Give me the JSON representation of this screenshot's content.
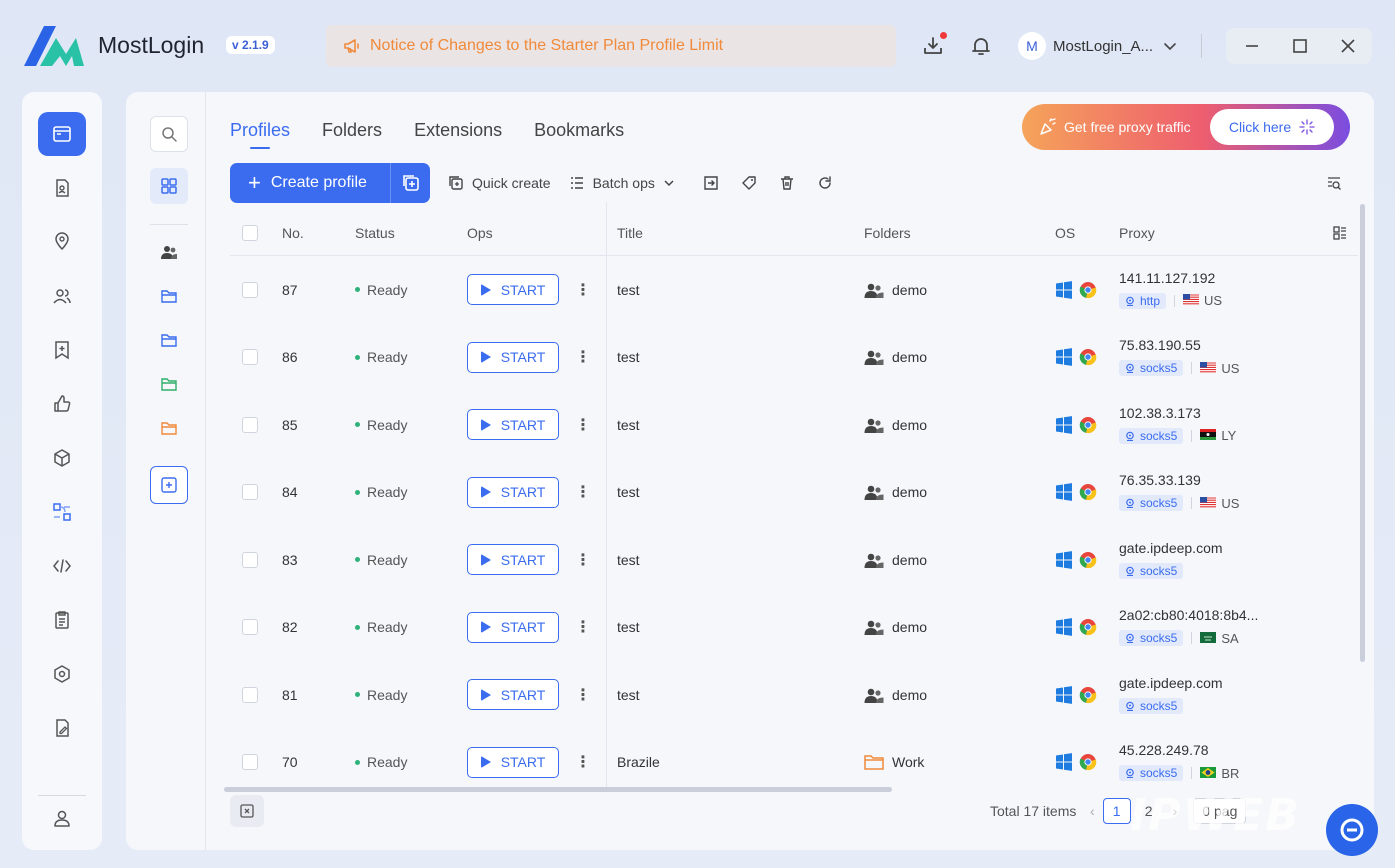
{
  "app": {
    "name": "MostLogin",
    "version": "v 2.1.9"
  },
  "notice": "Notice of Changes to the Starter Plan Profile Limit",
  "user": {
    "avatar_letter": "M",
    "name": "MostLogin_A..."
  },
  "tabs": [
    {
      "label": "Profiles",
      "active": true
    },
    {
      "label": "Folders",
      "active": false
    },
    {
      "label": "Extensions",
      "active": false
    },
    {
      "label": "Bookmarks",
      "active": false
    }
  ],
  "promo": {
    "text": "Get free proxy traffic",
    "button": "Click here"
  },
  "toolbar": {
    "create_label": "Create profile",
    "quick_create": "Quick create",
    "batch_ops": "Batch ops"
  },
  "table": {
    "headers": {
      "no": "No.",
      "status": "Status",
      "ops": "Ops",
      "title": "Title",
      "folders": "Folders",
      "os": "OS",
      "proxy": "Proxy"
    },
    "start_label": "START",
    "rows": [
      {
        "no": "87",
        "status": "Ready",
        "title": "test",
        "folder": "demo",
        "folder_type": "group",
        "proxy_host": "141.11.127.192",
        "proxy_type": "http",
        "country": "US"
      },
      {
        "no": "86",
        "status": "Ready",
        "title": "test",
        "folder": "demo",
        "folder_type": "group",
        "proxy_host": "75.83.190.55",
        "proxy_type": "socks5",
        "country": "US"
      },
      {
        "no": "85",
        "status": "Ready",
        "title": "test",
        "folder": "demo",
        "folder_type": "group",
        "proxy_host": "102.38.3.173",
        "proxy_type": "socks5",
        "country": "LY"
      },
      {
        "no": "84",
        "status": "Ready",
        "title": "test",
        "folder": "demo",
        "folder_type": "group",
        "proxy_host": "76.35.33.139",
        "proxy_type": "socks5",
        "country": "US"
      },
      {
        "no": "83",
        "status": "Ready",
        "title": "test",
        "folder": "demo",
        "folder_type": "group",
        "proxy_host": "gate.ipdeep.com",
        "proxy_type": "socks5",
        "country": ""
      },
      {
        "no": "82",
        "status": "Ready",
        "title": "test",
        "folder": "demo",
        "folder_type": "group",
        "proxy_host": "2a02:cb80:4018:8b4...",
        "proxy_type": "socks5",
        "country": "SA"
      },
      {
        "no": "81",
        "status": "Ready",
        "title": "test",
        "folder": "demo",
        "folder_type": "group",
        "proxy_host": "gate.ipdeep.com",
        "proxy_type": "socks5",
        "country": ""
      },
      {
        "no": "70",
        "status": "Ready",
        "title": "Brazile",
        "folder": "Work",
        "folder_type": "folder",
        "proxy_host": "45.228.249.78",
        "proxy_type": "socks5",
        "country": "BR"
      }
    ]
  },
  "footer": {
    "total": "Total 17 items",
    "pages": [
      "1",
      "2"
    ],
    "page_size": "0 pag"
  },
  "watermark": "IPWEB",
  "colors": {
    "accent": "#3b6cf0",
    "ready": "#2fb27a",
    "notice": "#f08a3a"
  }
}
